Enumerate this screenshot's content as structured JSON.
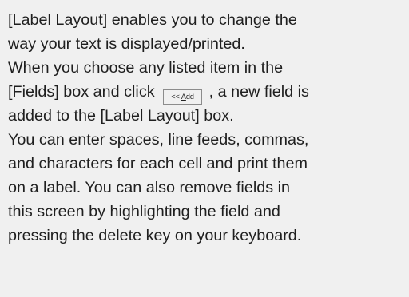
{
  "help_text": {
    "lines": [
      "[Label Layout] enables you to change the",
      "way your text is displayed/printed.",
      "When you choose any listed item in the",
      "[Fields] box and click",
      ", a new field is",
      "added to the [Label Layout] box.",
      "You can enter spaces, line feeds, commas,",
      "and characters for each cell and print them",
      "on a label. You can also remove fields in",
      "this screen by highlighting the field and",
      "pressing the delete key on your keyboard."
    ]
  },
  "add_button": {
    "prefix": "<< ",
    "accelerator": "A",
    "rest": "dd"
  }
}
